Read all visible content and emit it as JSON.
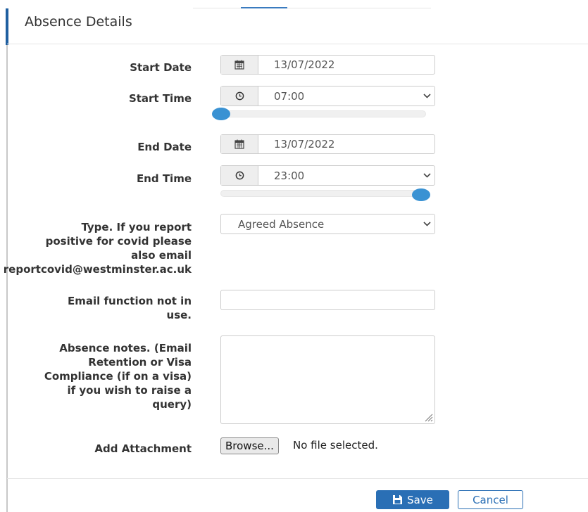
{
  "header": {
    "title": "Absence Details"
  },
  "form": {
    "start_date": {
      "label": "Start Date",
      "value": "13/07/2022"
    },
    "start_time": {
      "label": "Start Time",
      "value": "07:00",
      "slider_fraction": 0.0
    },
    "end_date": {
      "label": "End Date",
      "value": "13/07/2022"
    },
    "end_time": {
      "label": "End Time",
      "value": "23:00",
      "slider_fraction": 1.0
    },
    "type": {
      "label_lines": [
        "Type. If you report",
        "positive for covid please",
        "also email",
        "reportcovid@westminster.ac.uk"
      ],
      "selected": "Agreed Absence"
    },
    "email": {
      "label_lines": [
        "Email function not in",
        "use."
      ],
      "value": ""
    },
    "notes": {
      "label_lines": [
        "Absence notes. (Email",
        "Retention or Visa",
        "Compliance (if on a visa)",
        "if you wish to raise a",
        "query)"
      ],
      "value": ""
    },
    "attachment": {
      "label": "Add Attachment",
      "browse_label": "Browse...",
      "status": "No file selected."
    }
  },
  "footer": {
    "save_label": "Save",
    "cancel_label": "Cancel"
  },
  "icons": {
    "date": "calendar-icon",
    "time": "clock-icon",
    "dropdown": "chevron-down-icon",
    "save": "floppy-disk-icon"
  },
  "colors": {
    "primary": "#2a6fb5",
    "slider_knob": "#3a92d3"
  }
}
